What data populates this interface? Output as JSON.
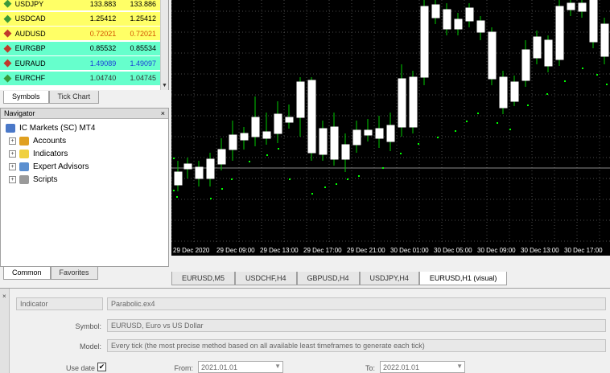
{
  "market_watch": {
    "rows": [
      {
        "symbol": "USDJPY",
        "bid": "133.883",
        "ask": "133.886",
        "bg": "#ffff66",
        "dot": "#3a9a3a"
      },
      {
        "symbol": "USDCAD",
        "bid": "1.25412",
        "ask": "1.25412",
        "bg": "#ffff66",
        "dot": "#3a9a3a"
      },
      {
        "symbol": "AUDUSD",
        "bid": "0.72021",
        "ask": "0.72021",
        "bg": "#ffff66",
        "dot": "#c0392b",
        "value_color": "#d35400"
      },
      {
        "symbol": "EURGBP",
        "bid": "0.85532",
        "ask": "0.85534",
        "bg": "#66ffcc",
        "dot": "#c0392b"
      },
      {
        "symbol": "EURAUD",
        "bid": "1.49089",
        "ask": "1.49097",
        "bg": "#66ffcc",
        "dot": "#c0392b",
        "value_color": "#1a3fd8"
      },
      {
        "symbol": "EURCHF",
        "bid": "1.04740",
        "ask": "1.04745",
        "bg": "#66ffcc",
        "dot": "#3a9a3a",
        "value_color": "#333333"
      }
    ],
    "tabs": [
      "Symbols",
      "Tick Chart"
    ]
  },
  "navigator": {
    "title": "Navigator",
    "close": "×",
    "root": "IC Markets (SC) MT4",
    "items": [
      "Accounts",
      "Indicators",
      "Expert Advisors",
      "Scripts"
    ],
    "tabs": [
      "Common",
      "Favorites"
    ]
  },
  "chart": {
    "time_labels": [
      "29 Dec 2020",
      "29 Dec 09:00",
      "29 Dec 13:00",
      "29 Dec 17:00",
      "29 Dec 21:00",
      "30 Dec 01:00",
      "30 Dec 05:00",
      "30 Dec 09:00",
      "30 Dec 13:00",
      "30 Dec 17:00"
    ],
    "tabs": [
      "EURUSD,M5",
      "USDCHF,H4",
      "GBPUSD,H4",
      "USDJPY,H4",
      "EURUSD,H1 (visual)"
    ],
    "active_tab": 4,
    "colors": {
      "bull": "#00cc00",
      "bear": "#ffffff",
      "grid": "#4a4a4a",
      "sar": "#00ff00",
      "axis_text": "#ffffff"
    }
  },
  "tester": {
    "strip_label": "×",
    "type_value": "Indicator",
    "indicator_value": "Parabolic.ex4",
    "symbol_label": "Symbol:",
    "symbol_value": "EURUSD, Euro vs US Dollar",
    "model_label": "Model:",
    "model_value": "Every tick (the most precise method based on all available least timeframes to generate each tick)",
    "use_date_label": "Use date",
    "use_date_check": "✔",
    "from_label": "From:",
    "from_value": "2021.01.01",
    "to_label": "To:",
    "to_value": "2022.01.01"
  }
}
